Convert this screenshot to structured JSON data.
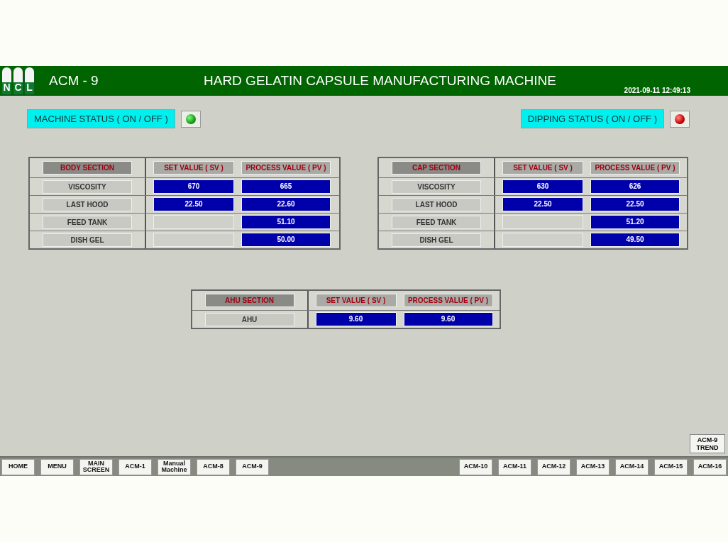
{
  "header": {
    "logo_letters": [
      "N",
      "C",
      "L"
    ],
    "machine": "ACM - 9",
    "title": "HARD GELATIN CAPSULE MANUFACTURING MACHINE",
    "datetime": "2021-09-11 12:49:13"
  },
  "status": [
    {
      "label": "MACHINE STATUS ( ON / OFF )",
      "on": true
    },
    {
      "label": "DIPPING STATUS ( ON / OFF )",
      "on": false
    }
  ],
  "sections": [
    {
      "title": "BODY SECTION",
      "sv_header": "SET VALUE ( SV )",
      "pv_header": "PROCESS VALUE ( PV )",
      "rows": [
        {
          "label": "VISCOSITY",
          "sv": "670",
          "pv": "665"
        },
        {
          "label": "LAST HOOD",
          "sv": "22.50",
          "pv": "22.60"
        },
        {
          "label": "FEED TANK",
          "pv": "51.10"
        },
        {
          "label": "DISH GEL",
          "pv": "50.00"
        }
      ]
    },
    {
      "title": "CAP SECTION",
      "sv_header": "SET VALUE ( SV )",
      "pv_header": "PROCESS VALUE ( PV )",
      "rows": [
        {
          "label": "VISCOSITY",
          "sv": "630",
          "pv": "626"
        },
        {
          "label": "LAST HOOD",
          "sv": "22.50",
          "pv": "22.50"
        },
        {
          "label": "FEED TANK",
          "pv": "51.20"
        },
        {
          "label": "DISH GEL",
          "pv": "49.50"
        }
      ]
    },
    {
      "title": "AHU SECTION",
      "sv_header": "SET VALUE ( SV )",
      "pv_header": "PROCESS VALUE ( PV )",
      "rows": [
        {
          "label": "AHU",
          "sv": "9.60",
          "pv": "9.60"
        }
      ]
    }
  ],
  "trend_button": "ACM-9 TREND",
  "nav": {
    "left": [
      "HOME",
      "MENU",
      "MAIN SCREEN",
      "ACM-1",
      "Manual Machine",
      "ACM-8",
      "ACM-9"
    ],
    "right": [
      "ACM-10",
      "ACM-11",
      "ACM-12",
      "ACM-13",
      "ACM-14",
      "ACM-15",
      "ACM-16"
    ]
  }
}
